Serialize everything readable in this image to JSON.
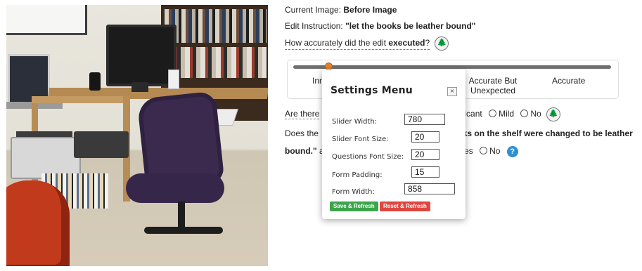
{
  "form": {
    "current_image_label": "Current Image:",
    "current_image_value": "Before Image",
    "edit_instruction_label": "Edit Instruction:",
    "edit_instruction_value": "\"let the books be leather bound\"",
    "q1_prefix": "How accurately did the edit ",
    "q1_bold": "executed",
    "q1_suffix": "?",
    "slider_labels": {
      "left": "Inn",
      "accurate_but_line1": "Accurate But",
      "accurate_but_line2": "Unexpected",
      "accurate": "Accurate"
    },
    "slider_value": 0.11,
    "q2_prefix": "Are there",
    "q2_options": [
      "ficant",
      "Mild",
      "No"
    ],
    "q3_line1_prefix": "Does the",
    "q3_line1_bold": "ks on the shelf were changed to be leather",
    "q3_line2_bold": "bound.\"",
    "q3_line2_suffix": " a",
    "q3_options": [
      "Yes",
      "No"
    ],
    "help_glyph": "?"
  },
  "icons": {
    "tree": "tree-icon",
    "help": "help-icon",
    "close": "close-icon"
  },
  "settings": {
    "title": "Settings Menu",
    "close_glyph": "×",
    "fields": [
      {
        "label": "Slider Width:",
        "value": "780"
      },
      {
        "label": "Slider Font Size:",
        "value": "20"
      },
      {
        "label": "Questions Font Size:",
        "value": "20"
      },
      {
        "label": "Form Padding:",
        "value": "15"
      },
      {
        "label": "Form Width:",
        "value": "858"
      }
    ],
    "save_label": "Save & Refresh",
    "reset_label": "Reset & Refresh"
  },
  "colors": {
    "slider_thumb": "#e4832f",
    "save": "#3ba54a",
    "reset": "#e0463f",
    "help": "#2f8fd1",
    "tree": "#1f8a2f"
  }
}
